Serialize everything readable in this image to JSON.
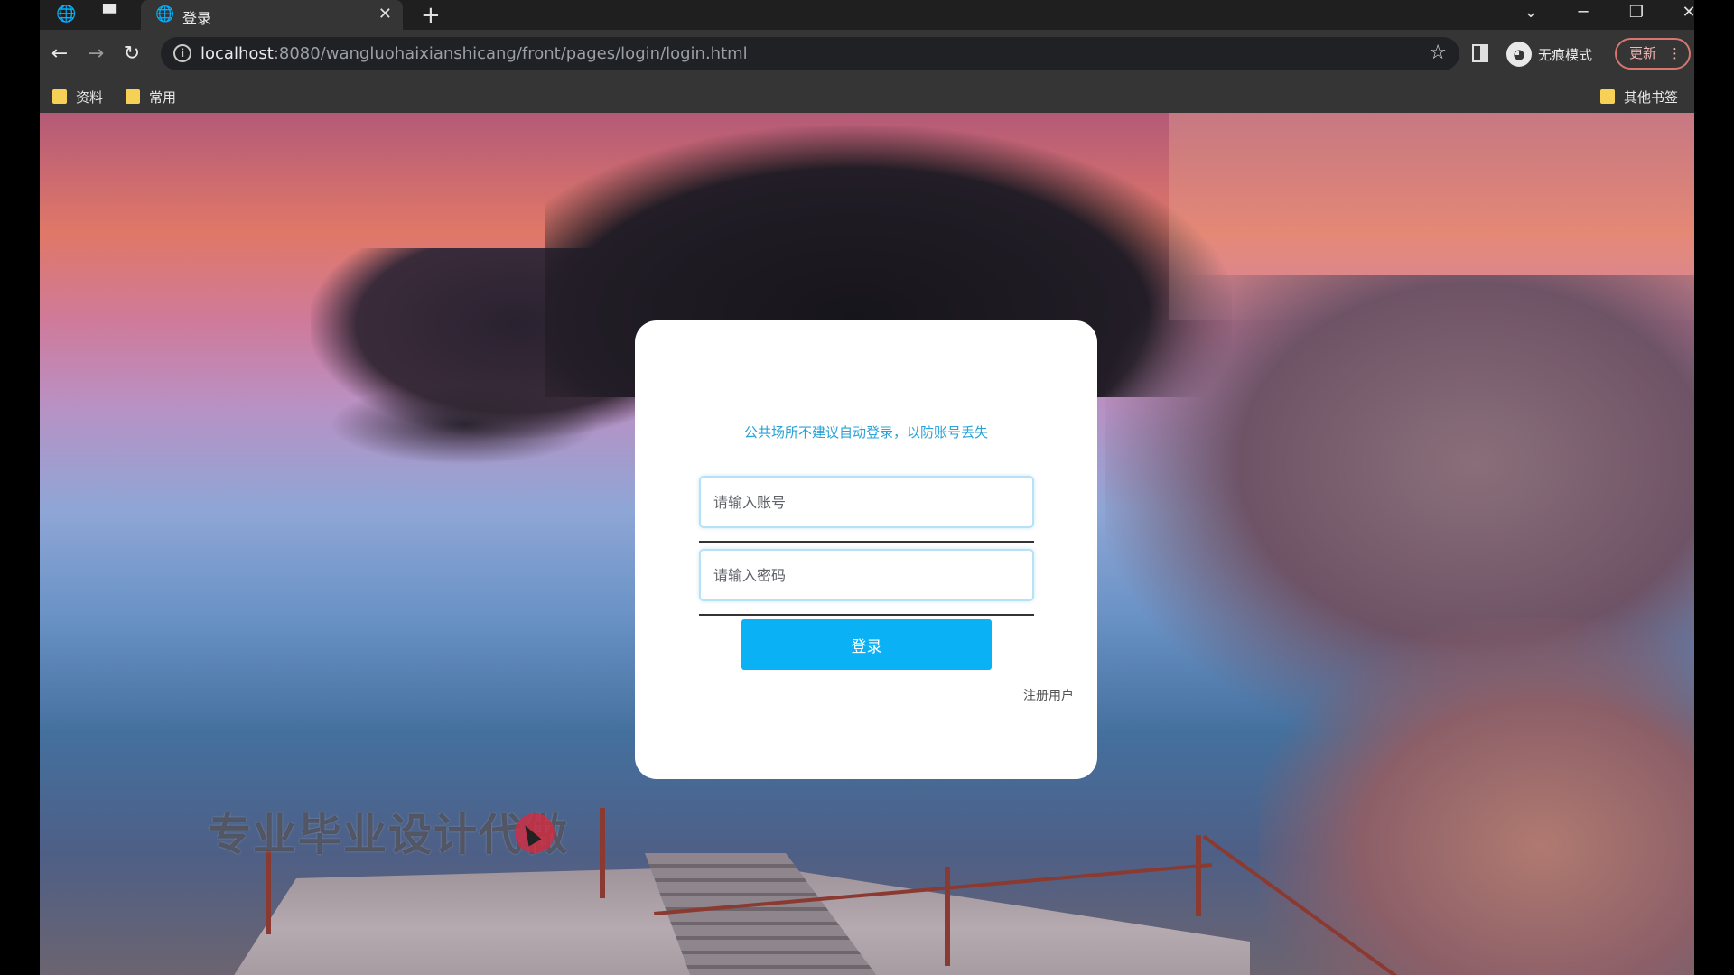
{
  "browser": {
    "tab_title": "登录",
    "new_tab_icon": "plus-icon",
    "url_host": "localhost",
    "url_rest": ":8080/wangluohaixianshicang/front/pages/login/login.html",
    "incognito_label": "无痕模式",
    "update_label": "更新",
    "bookmarks": [
      {
        "label": "资料"
      },
      {
        "label": "常用"
      }
    ],
    "other_bookmarks": "其他书签"
  },
  "login": {
    "hint": "公共场所不建议自动登录，以防账号丢失",
    "account_placeholder": "请输入账号",
    "password_placeholder": "请输入密码",
    "submit_label": "登录",
    "register_label": "注册用户",
    "accent_color": "#0bb1f5"
  },
  "overlay": {
    "watermark": "专业毕业设计代做"
  }
}
